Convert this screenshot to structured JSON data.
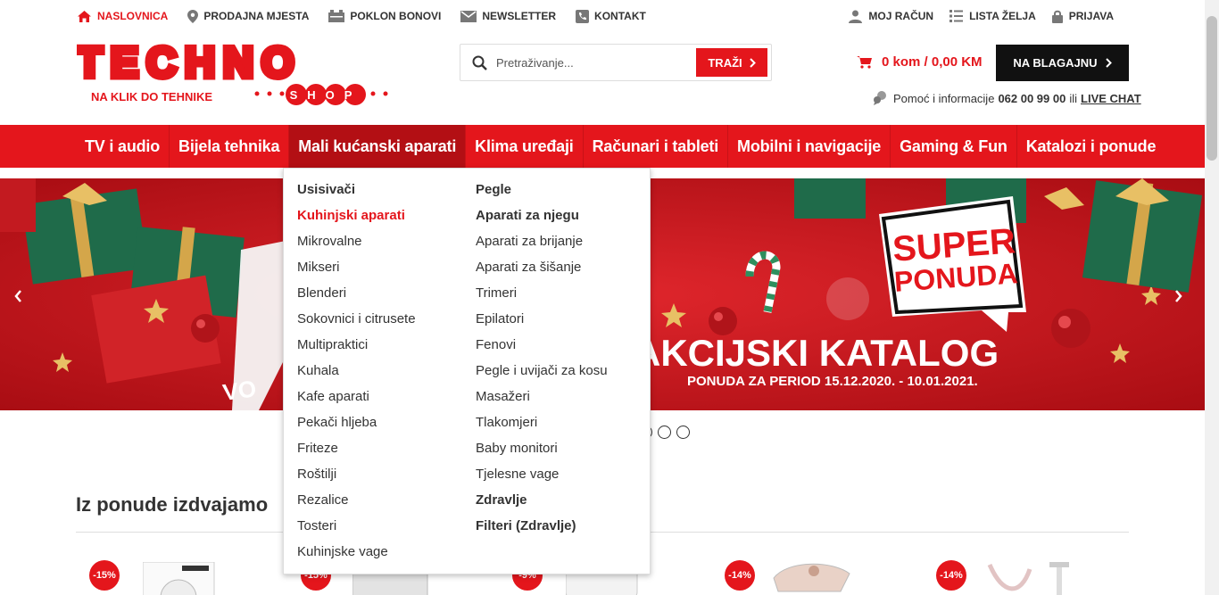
{
  "topnav": {
    "home": "NASLOVNICA",
    "stores": "PRODAJNA MJESTA",
    "gift": "POKLON BONOVI",
    "newsletter": "NEWSLETTER",
    "contact": "KONTAKT",
    "account": "MOJ RAČUN",
    "wishlist": "LISTA ŽELJA",
    "login": "PRIJAVA"
  },
  "logo": {
    "brand": "TECHNO",
    "tagline": "NA KLIK DO TEHNIKE",
    "sub": "SHOP"
  },
  "search": {
    "placeholder": "Pretraživanje...",
    "button": "TRAŽI"
  },
  "cart": {
    "summary": "0 kom / 0,00 KM",
    "checkout": "NA BLAGAJNU"
  },
  "help": {
    "text": "Pomoć i informacije",
    "phone": "062 00 99 00",
    "or": "ili",
    "chat": "LIVE CHAT"
  },
  "nav": [
    "TV i audio",
    "Bijela tehnika",
    "Mali kućanski aparati",
    "Klima uređaji",
    "Računari i tableti",
    "Mobilni i navigacije",
    "Gaming & Fun",
    "Katalozi i ponude"
  ],
  "dropdown": {
    "left": [
      {
        "label": "Usisivači",
        "style": "h"
      },
      {
        "label": "Kuhinjski aparati",
        "style": "red"
      },
      {
        "label": "Mikrovalne",
        "style": ""
      },
      {
        "label": "Mikseri",
        "style": ""
      },
      {
        "label": "Blenderi",
        "style": ""
      },
      {
        "label": "Sokovnici i citrusete",
        "style": ""
      },
      {
        "label": "Multipraktici",
        "style": ""
      },
      {
        "label": "Kuhala",
        "style": ""
      },
      {
        "label": "Kafe aparati",
        "style": ""
      },
      {
        "label": "Pekači hljeba",
        "style": ""
      },
      {
        "label": "Friteze",
        "style": ""
      },
      {
        "label": "Roštilji",
        "style": ""
      },
      {
        "label": "Rezalice",
        "style": ""
      },
      {
        "label": "Tosteri",
        "style": ""
      },
      {
        "label": "Kuhinjske vage",
        "style": ""
      }
    ],
    "right": [
      {
        "label": "Pegle",
        "style": "h"
      },
      {
        "label": "Aparati za njegu",
        "style": "h"
      },
      {
        "label": "Aparati za brijanje",
        "style": ""
      },
      {
        "label": "Aparati za šišanje",
        "style": ""
      },
      {
        "label": "Trimeri",
        "style": ""
      },
      {
        "label": "Epilatori",
        "style": ""
      },
      {
        "label": "Fenovi",
        "style": ""
      },
      {
        "label": "Pegle i uvijači za kosu",
        "style": ""
      },
      {
        "label": "Masažeri",
        "style": ""
      },
      {
        "label": "Tlakomjeri",
        "style": ""
      },
      {
        "label": "Baby monitori",
        "style": ""
      },
      {
        "label": "Tjelesne vage",
        "style": ""
      },
      {
        "label": "Zdravlje",
        "style": "h"
      },
      {
        "label": "Filteri (Zdravlje)",
        "style": "h"
      }
    ]
  },
  "hero": {
    "super": "SUPER",
    "ponuda": "PONUDA",
    "catalog": "AKCIJSKI KATALOG",
    "period": "PONUDA ZA PERIOD 15.12.2020. - 10.01.2021."
  },
  "section": {
    "title": "Iz ponude izdvajamo"
  },
  "badges": [
    "-15%",
    "-15%",
    "-9%",
    "-14%",
    "-14%"
  ],
  "colors": {
    "accent": "#e4161c",
    "dark": "#111111"
  }
}
